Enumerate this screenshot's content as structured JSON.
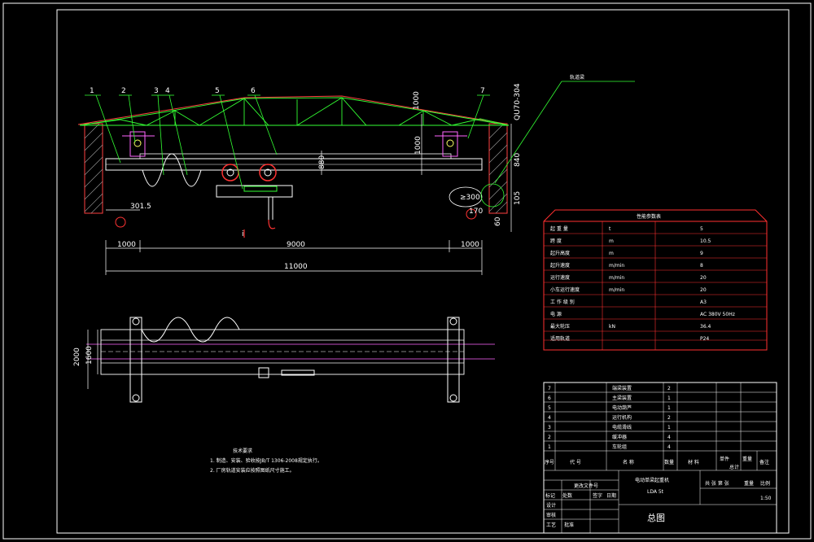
{
  "colors": {
    "background": "#000000",
    "frame": "#ffffff",
    "building": "#ff4040",
    "truss": "#33ff33",
    "dimension": "#ffffff",
    "leader": "#33ff33",
    "table_border": "#ff3030",
    "rail": "#ff66ff",
    "trolley": "#ff3333",
    "hatch": "#bbbbbb"
  },
  "part_labels": [
    "1",
    "2",
    "3",
    "4",
    "5",
    "6",
    "7"
  ],
  "dimensions": {
    "span_left": "1000",
    "span_mid": "9000",
    "span_right": "1000",
    "span_total": "11000",
    "offset_left": "301.5",
    "clearance_side": "≥300",
    "offset_right": "170",
    "v1": "1000",
    "v2": "880",
    "v3": "840",
    "v4": "1000",
    "v5": "1000",
    "v6": "1000",
    "v7": "60",
    "v8": "105",
    "plan_w1": "2000",
    "plan_w2": "1600"
  },
  "rail_note": "QU70-304",
  "callout": "轨道梁",
  "hook_mark": "i",
  "param_table": {
    "title": "性能参数表",
    "rows": [
      [
        "起 重 量",
        "t",
        "5"
      ],
      [
        "跨 度",
        "m",
        "10.5"
      ],
      [
        "起升高度",
        "m",
        "9"
      ],
      [
        "起升速度",
        "m/min",
        "8"
      ],
      [
        "运行速度",
        "m/min",
        "20"
      ],
      [
        "小车运行速度",
        "m/min",
        "20"
      ],
      [
        "工 作 级 别",
        "",
        "A3"
      ],
      [
        "电 源",
        "",
        "AC 380V 50Hz"
      ],
      [
        "最大轮压",
        "kN",
        "36.4"
      ],
      [
        "适用轨道",
        "",
        "P24"
      ]
    ]
  },
  "bom": {
    "rows": [
      [
        "7",
        "端梁装置",
        "2"
      ],
      [
        "6",
        "主梁装置",
        "1"
      ],
      [
        "5",
        "电动葫芦",
        "1"
      ],
      [
        "4",
        "运行机构",
        "2"
      ],
      [
        "3",
        "电缆滑线",
        "1"
      ],
      [
        "2",
        "缓冲器",
        "4"
      ],
      [
        "1",
        "车轮组",
        "4"
      ]
    ],
    "headers": [
      "序号",
      "代 号",
      "名 称",
      "数量",
      "材 料",
      "单件",
      "总计",
      "备注"
    ],
    "sub_headers": [
      "重量"
    ]
  },
  "title_block": {
    "name": "电动单梁起重机",
    "model": "LDA 5t",
    "drawing_title": "总图",
    "scale_label": "比例",
    "scale": "1:50",
    "weight_label": "重量",
    "sheet_label": "共 张 第 张",
    "roles": [
      "设计",
      "审核",
      "工艺",
      "批准"
    ],
    "marks": [
      "标记",
      "处数",
      "更改文件号",
      "签字",
      "日期"
    ]
  },
  "notes": {
    "title": "技术要求",
    "items": [
      "1. 制造、安装、验收按JB/T 1306-2008规定执行。",
      "2. 厂房轨道安装应按照图纸尺寸施工。"
    ]
  }
}
